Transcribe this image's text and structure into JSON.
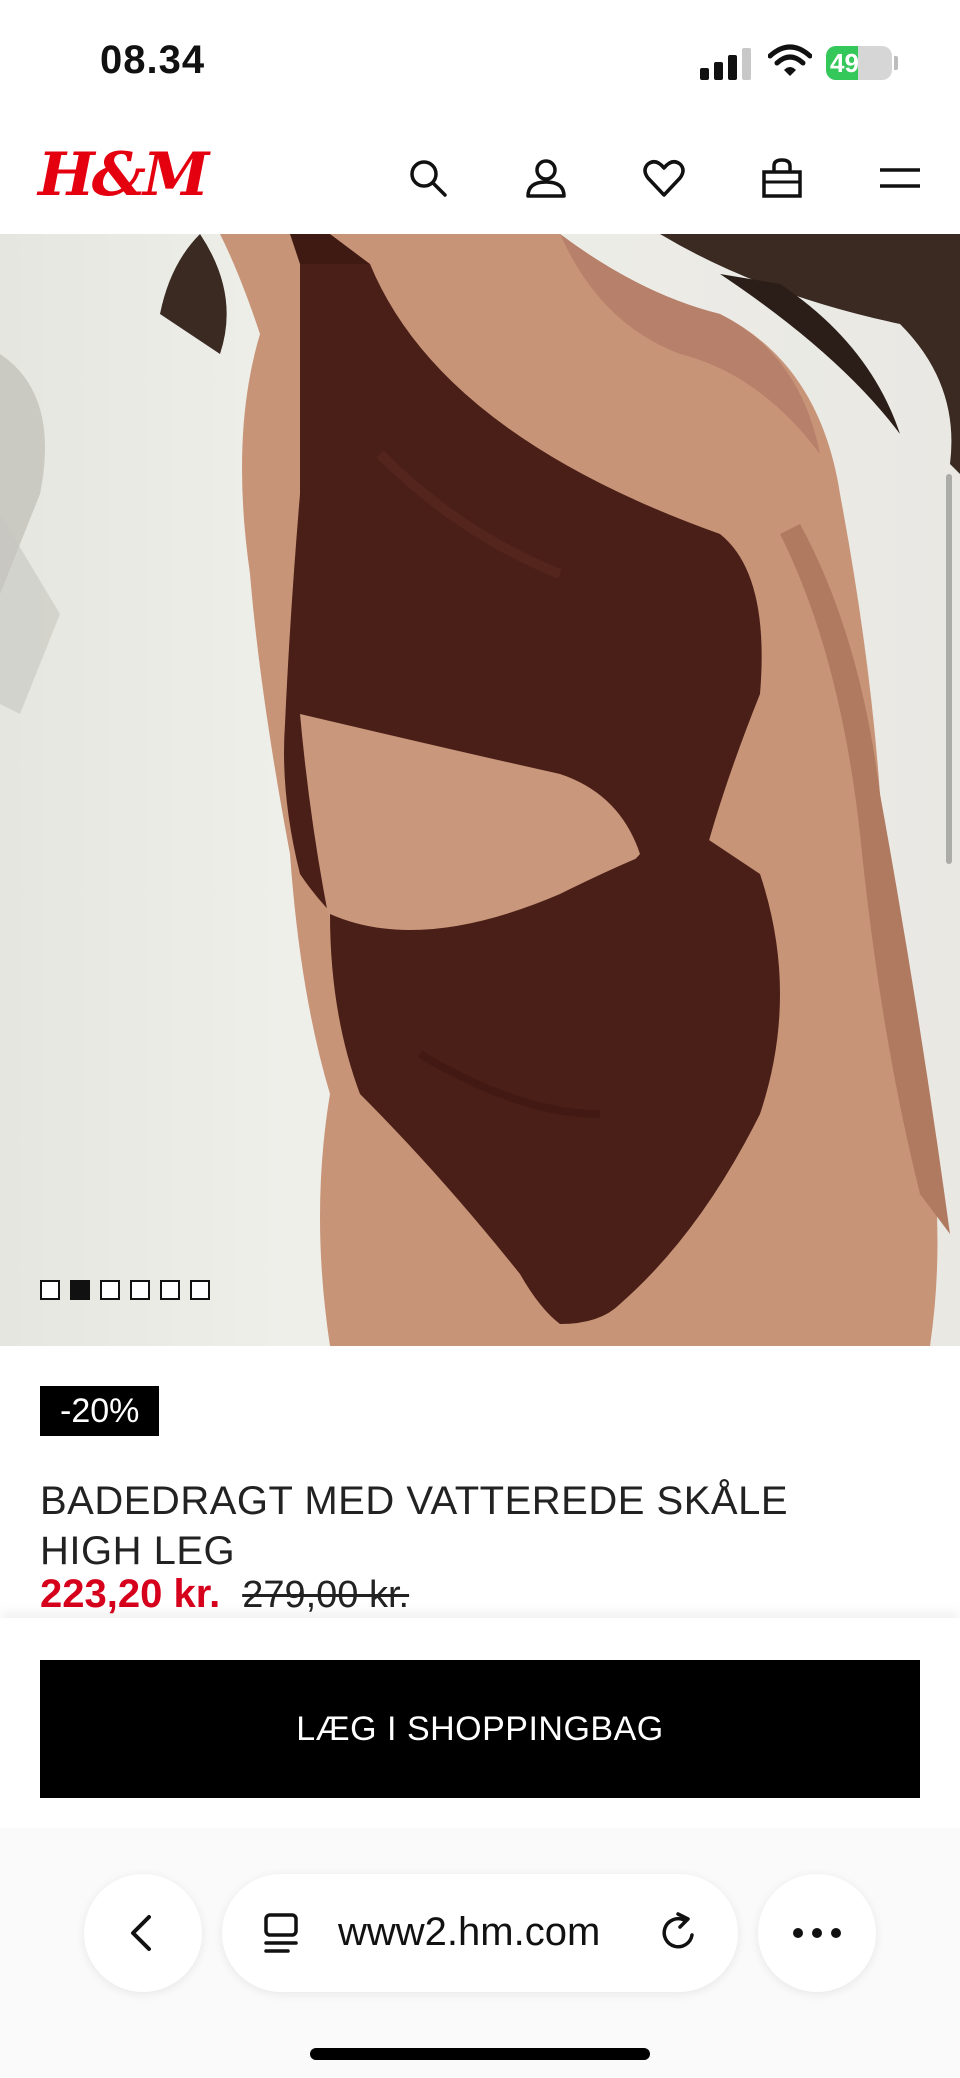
{
  "status_bar": {
    "time": "08.34",
    "battery_level": "49",
    "battery_fraction": 0.49,
    "signal_bars": 3,
    "icons": [
      "signal-icon",
      "wifi-icon",
      "battery-icon"
    ]
  },
  "header": {
    "logo_text": "H&M",
    "brand_color": "#e50010",
    "icons": [
      "search-icon",
      "account-icon",
      "favorites-icon",
      "shopping-bag-icon",
      "menu-icon"
    ]
  },
  "gallery": {
    "image_count": 6,
    "active_index": 1
  },
  "product": {
    "discount_badge": "-20%",
    "name": "BADEDRAGT MED VATTEREDE SKÅLE HIGH LEG",
    "sale_price": "223,20 kr.",
    "original_price": "279,00 kr.",
    "sale_color": "#d6001c"
  },
  "actions": {
    "add_to_bag_label": "LÆG I SHOPPINGBAG"
  },
  "browser": {
    "url": "www2.hm.com",
    "icons": [
      "back-icon",
      "tabs-icon",
      "reload-icon",
      "more-icon"
    ]
  }
}
